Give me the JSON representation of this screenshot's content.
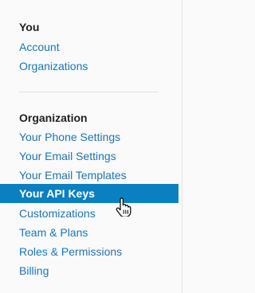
{
  "sections": {
    "you": {
      "title": "You",
      "items": [
        "Account",
        "Organizations"
      ]
    },
    "organization": {
      "title": "Organization",
      "items": [
        "Your Phone Settings",
        "Your Email Settings",
        "Your Email Templates",
        "Your API Keys",
        "Customizations",
        "Team & Plans",
        "Roles & Permissions",
        "Billing"
      ],
      "active_item": "Your API Keys"
    }
  },
  "colors": {
    "link": "#1b75b8",
    "active_bg": "#0a80c0",
    "active_text": "#ffffff",
    "heading": "#222222"
  },
  "icons": {
    "cursor": "hand-pointer-icon"
  }
}
